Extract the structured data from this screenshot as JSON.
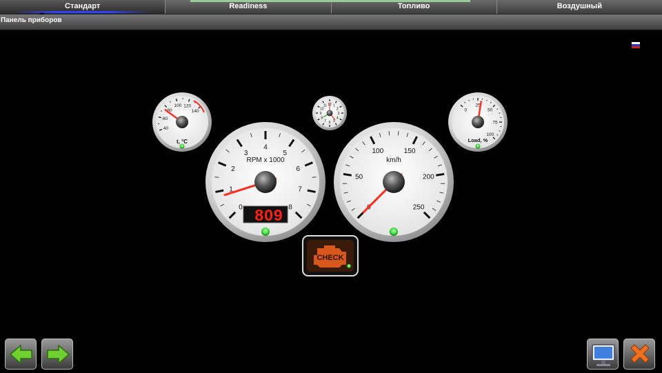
{
  "tabs": [
    {
      "label": "Стандарт",
      "active": true
    },
    {
      "label": "Readiness",
      "active": false
    },
    {
      "label": "Топливо",
      "active": false
    },
    {
      "label": "Воздушный",
      "active": false
    }
  ],
  "subheader": {
    "title": "Панель приборов"
  },
  "language_flag": {
    "icon": "russian-flag-icon",
    "colors": [
      "#ffffff",
      "#2040c0",
      "#d02020"
    ]
  },
  "gauges": {
    "temperature": {
      "label": "t, °C",
      "ticks": [
        "40",
        "60",
        "80",
        "100",
        "120",
        "140"
      ],
      "value": 75
    },
    "clock": {
      "ticks": [
        "12",
        "1",
        "2",
        "3",
        "4",
        "5",
        "6",
        "7",
        "8",
        "9",
        "10",
        "11"
      ]
    },
    "load": {
      "label": "Load, %",
      "ticks": [
        "0",
        "25",
        "50",
        "75",
        "100"
      ],
      "value": 30
    },
    "rpm": {
      "label": "RPM x 1000",
      "ticks": [
        "0",
        "1",
        "2",
        "3",
        "4",
        "5",
        "6",
        "7",
        "8"
      ],
      "value": 0.809,
      "display": "809"
    },
    "speed": {
      "label": "km/h",
      "ticks": [
        "0",
        "50",
        "100",
        "150",
        "200",
        "250"
      ],
      "value": 0
    }
  },
  "check_engine": {
    "label": "CHECK",
    "icon": "engine-icon"
  },
  "buttons": {
    "back": {
      "icon": "arrow-left-icon"
    },
    "forward": {
      "icon": "arrow-right-icon"
    },
    "display": {
      "icon": "monitor-icon"
    },
    "close": {
      "icon": "close-icon"
    }
  },
  "colors": {
    "accent_red": "#ff2a1a",
    "indicator_green": "#3cff3c",
    "check_orange": "#d8581c"
  }
}
